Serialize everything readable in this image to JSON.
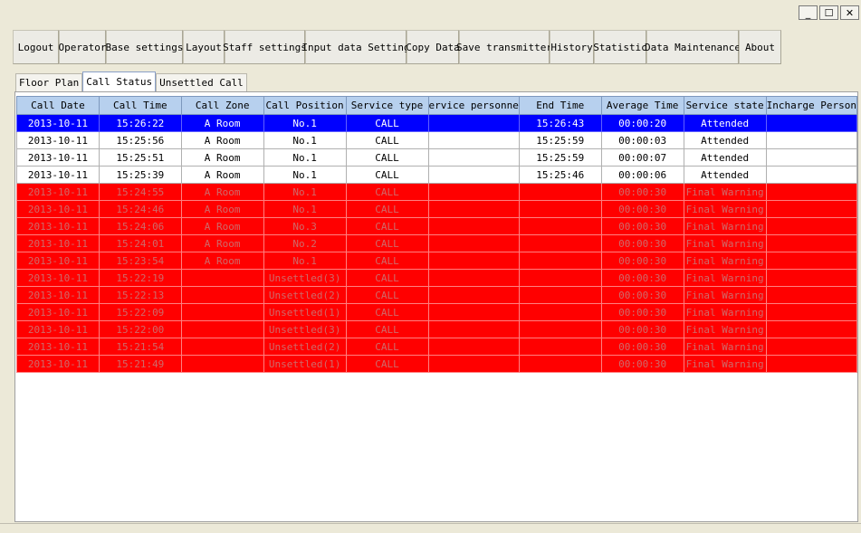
{
  "window": {
    "buttons": [
      {
        "name": "minimize",
        "glyph": "_"
      },
      {
        "name": "maximize",
        "glyph": "☐"
      },
      {
        "name": "close",
        "glyph": "✕"
      }
    ]
  },
  "toolbar": [
    "Logout",
    "Operator",
    "Base settings",
    "Layout",
    "Staff settings",
    "Input data Setting",
    "Copy Data",
    "Save transmitter",
    "History",
    "Statistic",
    "Data Maintenance",
    "About"
  ],
  "tabs": [
    {
      "label": "Floor Plan",
      "active": false
    },
    {
      "label": "Call Status",
      "active": true
    },
    {
      "label": "Unsettled Call",
      "active": false
    }
  ],
  "table": {
    "columns": [
      "Call Date",
      "Call Time",
      "Call Zone",
      "Call Position",
      "Service type",
      "ervice personne",
      "End Time",
      "Average Time",
      "Service state",
      "Incharge Person"
    ],
    "rows": [
      {
        "style": "sel",
        "cells": [
          "2013-10-11",
          "15:26:22",
          "A Room",
          "No.1",
          "CALL",
          "",
          "15:26:43",
          "00:00:20",
          "Attended",
          ""
        ]
      },
      {
        "style": "white",
        "cells": [
          "2013-10-11",
          "15:25:56",
          "A Room",
          "No.1",
          "CALL",
          "",
          "15:25:59",
          "00:00:03",
          "Attended",
          ""
        ]
      },
      {
        "style": "white",
        "cells": [
          "2013-10-11",
          "15:25:51",
          "A Room",
          "No.1",
          "CALL",
          "",
          "15:25:59",
          "00:00:07",
          "Attended",
          ""
        ]
      },
      {
        "style": "white",
        "cells": [
          "2013-10-11",
          "15:25:39",
          "A Room",
          "No.1",
          "CALL",
          "",
          "15:25:46",
          "00:00:06",
          "Attended",
          ""
        ]
      },
      {
        "style": "red",
        "cells": [
          "2013-10-11",
          "15:24:55",
          "A Room",
          "No.1",
          "CALL",
          "",
          "",
          "00:00:30",
          "Final Warning",
          ""
        ]
      },
      {
        "style": "red",
        "cells": [
          "2013-10-11",
          "15:24:46",
          "A Room",
          "No.1",
          "CALL",
          "",
          "",
          "00:00:30",
          "Final Warning",
          ""
        ]
      },
      {
        "style": "red",
        "cells": [
          "2013-10-11",
          "15:24:06",
          "A Room",
          "No.3",
          "CALL",
          "",
          "",
          "00:00:30",
          "Final Warning",
          ""
        ]
      },
      {
        "style": "red",
        "cells": [
          "2013-10-11",
          "15:24:01",
          "A Room",
          "No.2",
          "CALL",
          "",
          "",
          "00:00:30",
          "Final Warning",
          ""
        ]
      },
      {
        "style": "red",
        "cells": [
          "2013-10-11",
          "15:23:54",
          "A Room",
          "No.1",
          "CALL",
          "",
          "",
          "00:00:30",
          "Final Warning",
          ""
        ]
      },
      {
        "style": "red",
        "cells": [
          "2013-10-11",
          "15:22:19",
          "",
          "Unsettled(3)",
          "CALL",
          "",
          "",
          "00:00:30",
          "Final Warning",
          ""
        ]
      },
      {
        "style": "red",
        "cells": [
          "2013-10-11",
          "15:22:13",
          "",
          "Unsettled(2)",
          "CALL",
          "",
          "",
          "00:00:30",
          "Final Warning",
          ""
        ]
      },
      {
        "style": "red",
        "cells": [
          "2013-10-11",
          "15:22:09",
          "",
          "Unsettled(1)",
          "CALL",
          "",
          "",
          "00:00:30",
          "Final Warning",
          ""
        ]
      },
      {
        "style": "red",
        "cells": [
          "2013-10-11",
          "15:22:00",
          "",
          "Unsettled(3)",
          "CALL",
          "",
          "",
          "00:00:30",
          "Final Warning",
          ""
        ]
      },
      {
        "style": "red",
        "cells": [
          "2013-10-11",
          "15:21:54",
          "",
          "Unsettled(2)",
          "CALL",
          "",
          "",
          "00:00:30",
          "Final Warning",
          ""
        ]
      },
      {
        "style": "red",
        "cells": [
          "2013-10-11",
          "15:21:49",
          "",
          "Unsettled(1)",
          "CALL",
          "",
          "",
          "00:00:30",
          "Final Warning",
          ""
        ]
      }
    ]
  },
  "colors": {
    "selected_row": "#0000ff",
    "warning_row": "#ff0000",
    "header": "#b7d0ee"
  }
}
